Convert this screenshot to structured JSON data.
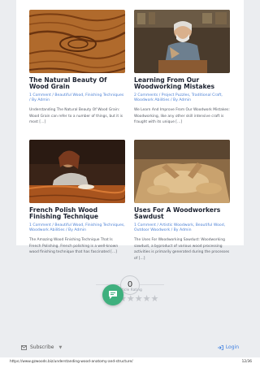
{
  "posts": [
    {
      "title": "The Natural Beauty Of Wood Grain",
      "meta": "1 Comment / Beautiful Wood, Finishing Techniques / By Admin",
      "excerpt": "Understanding The Natural Beauty Of Wood Grain: Wood Grain can refer to a number of things, but it is most […]"
    },
    {
      "title": "Learning From Our Woodworking Mistakes",
      "meta": "2 Comments / Project Puzzles, Traditional Craft, Woodwork Abilities / By Admin",
      "excerpt": "We Learn And Improve From Our Woodwork Mistakes: Woodworking, like any other skill intensive craft is fraught with its unique […]"
    },
    {
      "title": "French Polish Wood Finishing Technique",
      "meta": "1 Comment / Beautiful Wood, Finishing Techniques, Woodwork Abilities / By Admin",
      "excerpt": "The Amazing Wood Finishing Technique That Is French Polishing. French polishing is a well-known wood finishing technique that has fascinated […]"
    },
    {
      "title": "Uses For A Woodworkers Sawdust",
      "meta": "1 Comment / Artistic Woodwork, Beautiful Wood, Outdoor Woodwork / By Admin",
      "excerpt": "The Uses For Woodworking Sawdust: Woodworking sawdust, a byproduct of various wood processing activities is primarily generated during the processes of […]"
    }
  ],
  "rating": {
    "count": "0",
    "label": "Article Rating",
    "stars": "★★★★★",
    "star_fraction": 0
  },
  "bottombar": {
    "subscribe_label": "Subscribe",
    "login_label": "Login"
  },
  "footer": {
    "url": "https://www.gzwoods.biz/understanding-wood-anatomy-and-structure/",
    "page": "12/36"
  },
  "colors": {
    "accent": "#4a7fd4",
    "chat_button": "#3fb07e",
    "background": "#ebedf0"
  },
  "icons": {
    "subscribe": "envelope-icon",
    "chevron": "chevron-down-icon",
    "login": "login-arrow-icon",
    "chat": "chat-bubble-icon"
  }
}
